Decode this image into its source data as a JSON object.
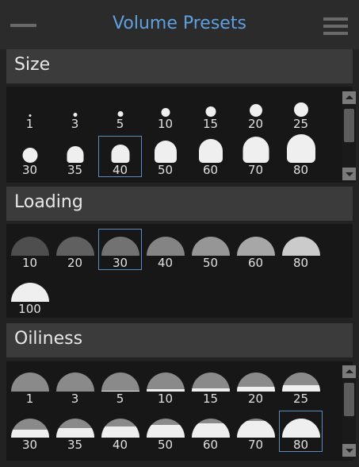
{
  "window": {
    "title": "Volume Presets",
    "minimize_icon": "minimize-icon",
    "menu_icon": "hamburger-menu-icon"
  },
  "colors": {
    "title": "#5fa0e0",
    "selection": "#5a8bc0",
    "swatch_light": "#efefef",
    "swatch_dark": "#4a4a4a"
  },
  "sections": {
    "size": {
      "label": "Size",
      "selected": "40",
      "items": [
        "1",
        "3",
        "5",
        "10",
        "15",
        "20",
        "25",
        "30",
        "35",
        "40",
        "50",
        "60",
        "70",
        "80"
      ]
    },
    "loading": {
      "label": "Loading",
      "selected": "30",
      "items": [
        "10",
        "20",
        "30",
        "40",
        "50",
        "60",
        "80",
        "100"
      ]
    },
    "oiliness": {
      "label": "Oiliness",
      "selected": "80",
      "items": [
        "1",
        "3",
        "5",
        "10",
        "15",
        "20",
        "25",
        "30",
        "35",
        "40",
        "50",
        "60",
        "70",
        "80"
      ]
    }
  }
}
